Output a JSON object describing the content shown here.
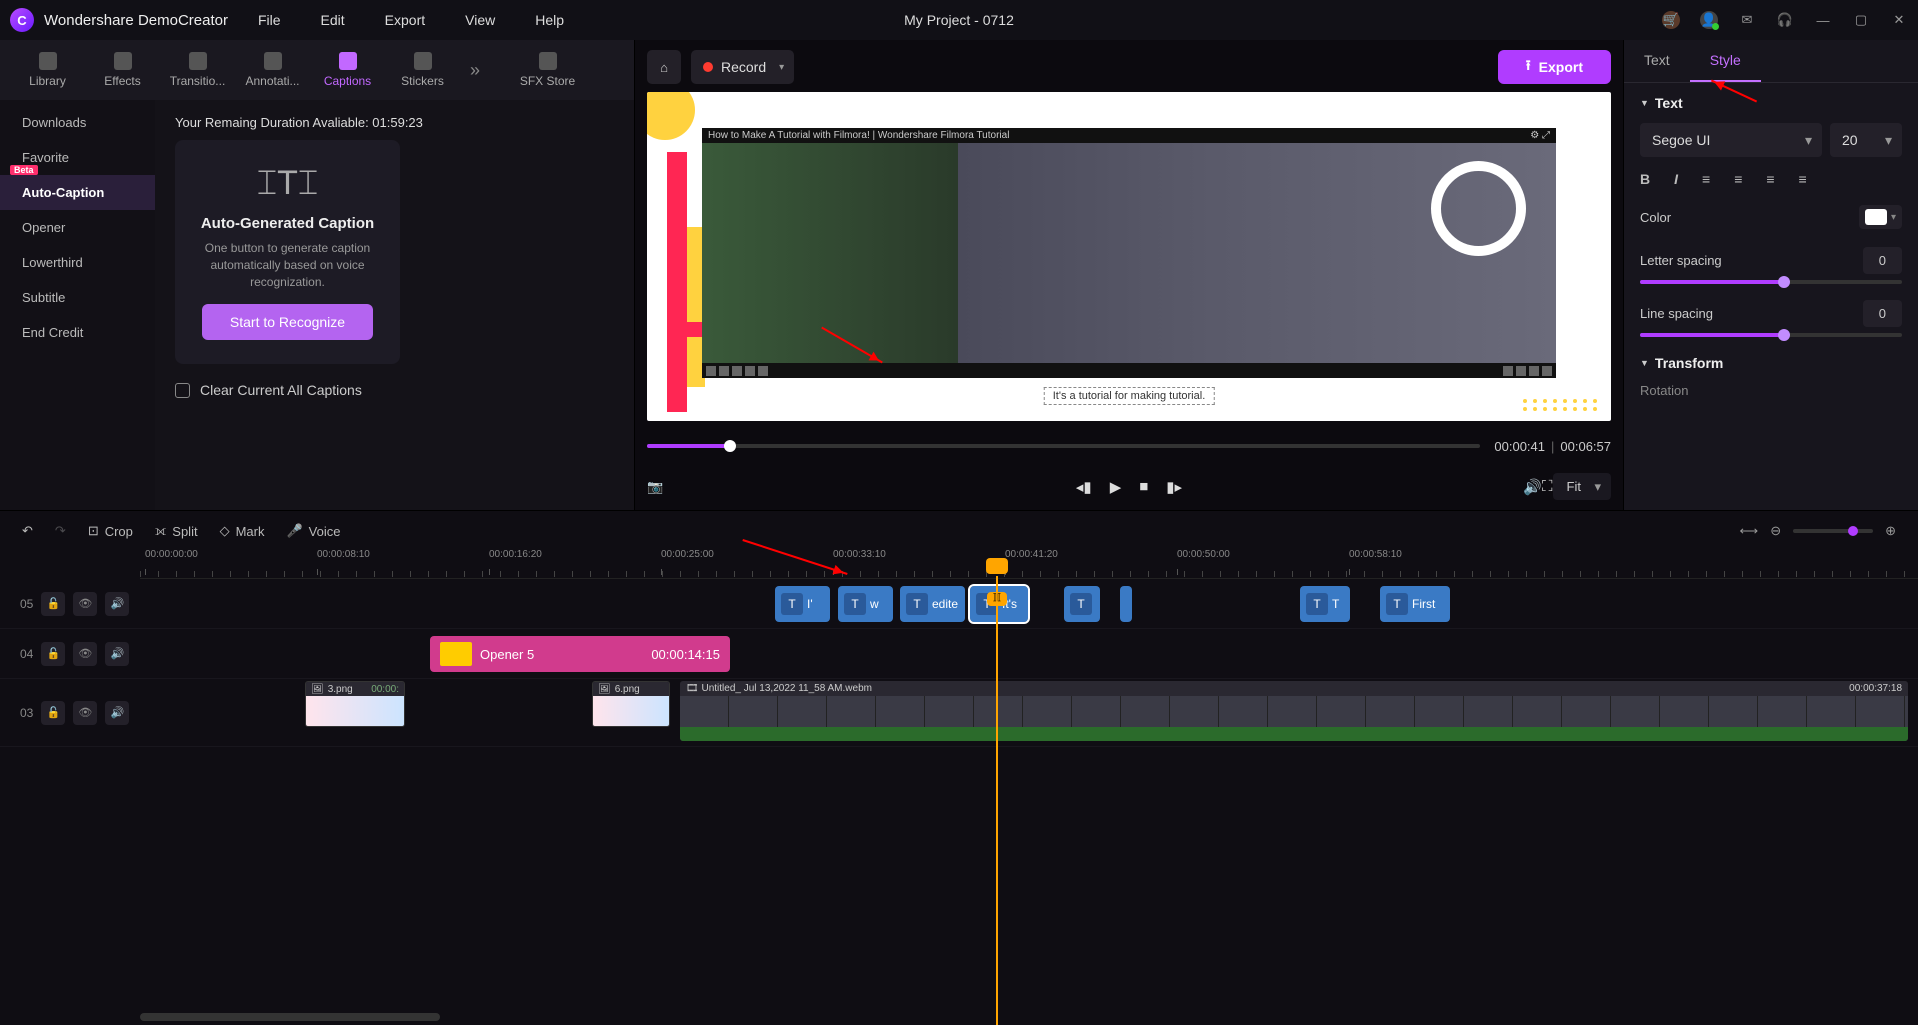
{
  "app": {
    "name": "Wondershare DemoCreator",
    "project": "My Project - 0712"
  },
  "menu": {
    "file": "File",
    "edit": "Edit",
    "export": "Export",
    "view": "View",
    "help": "Help"
  },
  "nav": {
    "library": "Library",
    "effects": "Effects",
    "transitions": "Transitio...",
    "annotations": "Annotati...",
    "captions": "Captions",
    "stickers": "Stickers",
    "sfx": "SFX Store"
  },
  "sidebar": {
    "downloads": "Downloads",
    "favorite": "Favorite",
    "auto": "Auto-Caption",
    "opener": "Opener",
    "lowerthird": "Lowerthird",
    "subtitle": "Subtitle",
    "endcredit": "End Credit",
    "beta": "Beta"
  },
  "captionPanel": {
    "remaining": "Your Remaing Duration Avaliable: 01:59:23",
    "title": "Auto-Generated Caption",
    "desc": "One button to generate caption automatically based on voice recognization.",
    "button": "Start to Recognize",
    "clear": "Clear Current All Captions"
  },
  "preview": {
    "record": "Record",
    "export": "Export",
    "videoTitle": "How to Make A Tutorial with Filmora! | Wondershare Filmora Tutorial",
    "captionText": "It's a tutorial for making tutorial.",
    "currentTime": "00:00:41",
    "totalTime": "00:06:57",
    "fit": "Fit"
  },
  "props": {
    "tabs": {
      "text": "Text",
      "style": "Style"
    },
    "textHeader": "Text",
    "fontName": "Segoe UI",
    "fontSize": "20",
    "colorLabel": "Color",
    "letterSpacing": {
      "label": "Letter spacing",
      "value": "0"
    },
    "lineSpacing": {
      "label": "Line spacing",
      "value": "0"
    },
    "transform": "Transform",
    "rotation": "Rotation"
  },
  "timeline": {
    "tools": {
      "crop": "Crop",
      "split": "Split",
      "mark": "Mark",
      "voice": "Voice"
    },
    "ticks": [
      "00:00:00:00",
      "00:00:08:10",
      "00:00:16:20",
      "00:00:25:00",
      "00:00:33:10",
      "00:00:41:20",
      "00:00:50:00",
      "00:00:58:10"
    ],
    "tracks": {
      "t5": "05",
      "t4": "04",
      "t3": "03"
    },
    "captions": {
      "c1": "I'",
      "c2": "w",
      "c3": "edite",
      "c4": "It's",
      "c5": "T",
      "c6": "First"
    },
    "opener": {
      "name": "Opener 5",
      "dur": "00:00:14:15"
    },
    "imgclip1": {
      "name": "3.png",
      "time": "00:00:"
    },
    "imgclip2": {
      "name": "6.png"
    },
    "videoclip": {
      "name": "Untitled_ Jul 13,2022 11_58 AM.webm",
      "dur": "00:00:37:18"
    },
    "playhead_marker": "⟧⟦"
  }
}
